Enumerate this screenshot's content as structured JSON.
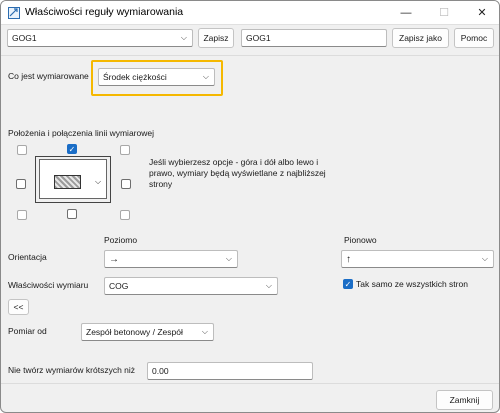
{
  "window": {
    "title": "Właściwości reguły wymiarowania"
  },
  "controls": {
    "minimize": "—",
    "maximize": "☐",
    "close": "✕"
  },
  "top": {
    "rule_select": "GOG1",
    "save_label": "Zapisz",
    "name_input": "GOG1",
    "save_as_label": "Zapisz jako",
    "help_label": "Pomoc"
  },
  "measured": {
    "label": "Co jest wymiarowane",
    "value": "Środek ciężkości"
  },
  "positions": {
    "title": "Położenia i połączenia linii wymiarowej",
    "info": "Jeśli wybierzesz opcje - góra i dół albo lewo i prawo, wymiary będą wyświetlane z najbliższej strony"
  },
  "orientation": {
    "horizontal_header": "Poziomo",
    "vertical_header": "Pionowo",
    "label": "Orientacja",
    "horizontal_value": "→",
    "vertical_value": "↑"
  },
  "dim_props": {
    "label": "Właściwości wymiaru",
    "value": "COG",
    "same_label": "Tak samo ze wszystkich stron",
    "same_checked": true
  },
  "collapse_label": "<<",
  "measure_from": {
    "label": "Pomiar od",
    "value": "Zespół betonowy / Zespół"
  },
  "min_dim": {
    "label": "Nie twórz wymiarów krótszych niż",
    "value": "0.00"
  },
  "close_label": "Zamknij"
}
